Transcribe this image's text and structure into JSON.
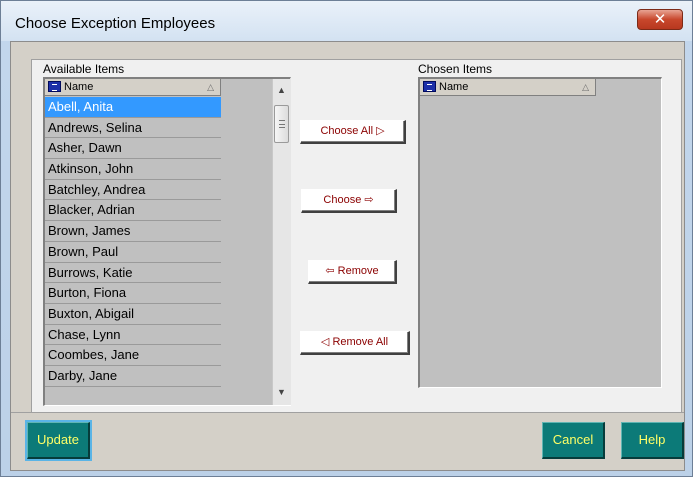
{
  "window": {
    "title": "Choose Exception Employees",
    "close_glyph": "✕"
  },
  "available": {
    "label": "Available Items",
    "column_header": "Name",
    "sort_glyph": "△",
    "rows": [
      "Abell, Anita",
      "Andrews, Selina",
      "Asher, Dawn",
      "Atkinson, John",
      "Batchley, Andrea",
      "Blacker, Adrian",
      "Brown, James",
      "Brown, Paul",
      "Burrows, Katie",
      "Burton, Fiona",
      "Buxton, Abigail",
      "Chase, Lynn",
      "Coombes, Jane",
      "Darby, Jane"
    ],
    "selected_index": 0,
    "scroll_up": "▲",
    "scroll_down": "▼"
  },
  "chosen": {
    "label": "Chosen Items",
    "column_header": "Name",
    "sort_glyph": "△"
  },
  "transfer_buttons": {
    "choose_all": "Choose All ▷",
    "choose": "Choose ⇨",
    "remove": "⇦ Remove",
    "remove_all": "◁ Remove All"
  },
  "footer": {
    "update": "Update",
    "cancel": "Cancel",
    "help": "Help"
  },
  "colors": {
    "selection": "#3399ff",
    "action_button_bg": "#0c7a78",
    "action_button_text": "#ffff66",
    "transfer_button_text": "#8b0000"
  }
}
